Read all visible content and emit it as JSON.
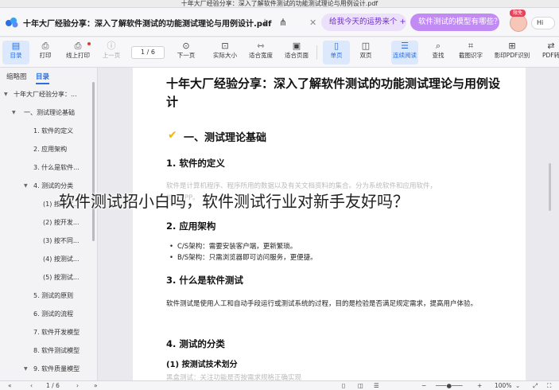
{
  "window": {
    "title": "十年大厂经验分享：深入了解软件测试的功能测试理论与用例设计.pdf"
  },
  "header": {
    "doc_title": "十年大厂经验分享：深入了解软件测试的功能测试理论与用例设计.pdf",
    "pill_fortune": "给我今天的运势来个 +",
    "pill_model": "软件测试的模型有哪些？",
    "vip_badge": "限免",
    "user_greeting": "Hi"
  },
  "toolbar": {
    "items": [
      {
        "label": "目录",
        "icon": "sidebar-icon"
      },
      {
        "label": "打印",
        "icon": "print-icon"
      },
      {
        "label": "线上打印",
        "icon": "cloud-print-icon"
      },
      {
        "label": "上一页",
        "icon": "prev-page-icon"
      },
      {
        "label": "下一页",
        "icon": "next-page-icon"
      },
      {
        "label": "实际大小",
        "icon": "actual-size-icon"
      },
      {
        "label": "适合宽度",
        "icon": "fit-width-icon"
      },
      {
        "label": "适合页面",
        "icon": "fit-page-icon"
      },
      {
        "label": "单页",
        "icon": "single-page-icon"
      },
      {
        "label": "双页",
        "icon": "double-page-icon"
      },
      {
        "label": "连续阅读",
        "icon": "continuous-icon"
      },
      {
        "label": "查找",
        "icon": "search-icon"
      },
      {
        "label": "截图识字",
        "icon": "screenshot-ocr-icon"
      },
      {
        "label": "影印PDF识别",
        "icon": "scan-pdf-icon"
      },
      {
        "label": "PDF转",
        "icon": "pdf-convert-icon"
      }
    ],
    "page_current": "1",
    "page_total": "6",
    "page_display": "1  /  6"
  },
  "sidebar": {
    "tab_thumbs": "缩略图",
    "tab_toc": "目录",
    "toc": [
      {
        "label": "十年大厂经验分享：...",
        "level": 0
      },
      {
        "label": "一、测试理论基础",
        "level": 1
      },
      {
        "label": "1. 软件的定义",
        "level": 2
      },
      {
        "label": "2. 应用架构",
        "level": 2
      },
      {
        "label": "3. 什么是软件...",
        "level": 2
      },
      {
        "label": "4. 测试的分类",
        "level": 2
      },
      {
        "label": "(1) 按测试...",
        "level": 3
      },
      {
        "label": "(2) 按开发...",
        "level": 3
      },
      {
        "label": "(3) 按不同...",
        "level": 3
      },
      {
        "label": "(4) 按测试...",
        "level": 3
      },
      {
        "label": "(5) 按测试...",
        "level": 3
      },
      {
        "label": "5. 测试的原则",
        "level": 2
      },
      {
        "label": "6. 测试的流程",
        "level": 2
      },
      {
        "label": "7. 软件开发模型",
        "level": 2
      },
      {
        "label": "8. 软件测试模型",
        "level": 2
      },
      {
        "label": "9. 软件质量模型",
        "level": 2
      }
    ]
  },
  "document": {
    "title": "十年大厂经验分享：深入了解软件测试的功能测试理论与用例设计",
    "section1": "一、测试理论基础",
    "h_def": "1. 软件的定义",
    "p_def": "软件是计算机程序、程序所用的数据以及有关文档资料的集合。分为系统软件和应用软件，",
    "p_def2": "如：APP。",
    "h_arch": "2. 应用架构",
    "b_cs": "C/S架构：需要安装客户端，更新繁琐。",
    "b_bs": "B/S架构：只需浏览器即可访问服务，更便捷。",
    "h_what": "3. 什么是软件测试",
    "p_what": "软件测试是使用人工和自动手段运行或测试系统的过程，目的是检验是否满足规定需求，提高用户体验。",
    "h_class": "4. 测试的分类",
    "h_tech": "(1) 按测试技术划分",
    "p_tech": "黑盒测试：关注功能是否按需求规格正确实现"
  },
  "overlay": {
    "caption": "软件测试招小白吗，软件测试行业对新手友好吗？"
  },
  "bottombar": {
    "page_display": "1  /  6",
    "zoom": "100%"
  }
}
